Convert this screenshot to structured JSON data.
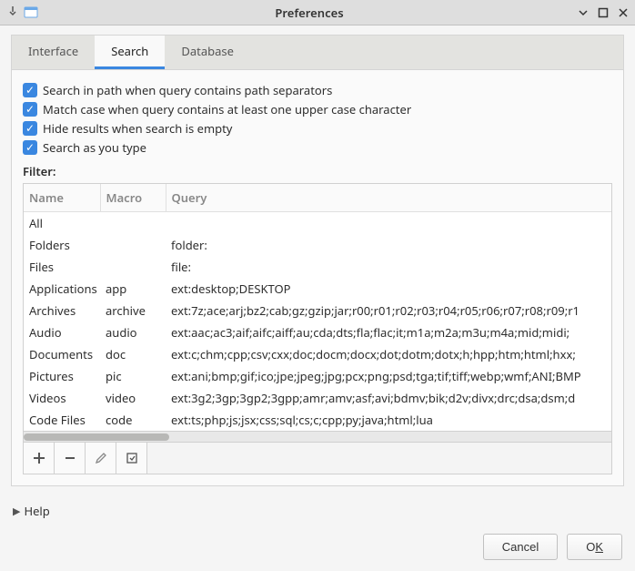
{
  "window": {
    "title": "Preferences"
  },
  "tabs": {
    "interface": "Interface",
    "search": "Search",
    "database": "Database"
  },
  "checks": {
    "path_sep": "Search in path when query contains path separators",
    "match_case": "Match case when query contains at least one upper case character",
    "hide_empty": "Hide results when search is empty",
    "as_you_type": "Search as you type"
  },
  "filter_label": "Filter:",
  "headers": {
    "name": "Name",
    "macro": "Macro",
    "query": "Query"
  },
  "rows": [
    {
      "name": "All",
      "macro": "",
      "query": ""
    },
    {
      "name": "Folders",
      "macro": "",
      "query": "folder:"
    },
    {
      "name": "Files",
      "macro": "",
      "query": "file:"
    },
    {
      "name": "Applications",
      "macro": "app",
      "query": "ext:desktop;DESKTOP"
    },
    {
      "name": "Archives",
      "macro": "archive",
      "query": "ext:7z;ace;arj;bz2;cab;gz;gzip;jar;r00;r01;r02;r03;r04;r05;r06;r07;r08;r09;r1"
    },
    {
      "name": "Audio",
      "macro": "audio",
      "query": "ext:aac;ac3;aif;aifc;aiff;au;cda;dts;fla;flac;it;m1a;m2a;m3u;m4a;mid;midi;"
    },
    {
      "name": "Documents",
      "macro": "doc",
      "query": "ext:c;chm;cpp;csv;cxx;doc;docm;docx;dot;dotm;dotx;h;hpp;htm;html;hxx;"
    },
    {
      "name": "Pictures",
      "macro": "pic",
      "query": "ext:ani;bmp;gif;ico;jpe;jpeg;jpg;pcx;png;psd;tga;tif;tiff;webp;wmf;ANI;BMP"
    },
    {
      "name": "Videos",
      "macro": "video",
      "query": "ext:3g2;3gp;3gp2;3gpp;amr;amv;asf;avi;bdmv;bik;d2v;divx;drc;dsa;dsm;d"
    },
    {
      "name": "Code Files",
      "macro": "code",
      "query": "ext:ts;php;js;jsx;css;sql;cs;c;cpp;py;java;html;lua"
    }
  ],
  "help": "Help",
  "buttons": {
    "cancel": "Cancel",
    "ok_pre": "O",
    "ok_u": "K"
  }
}
